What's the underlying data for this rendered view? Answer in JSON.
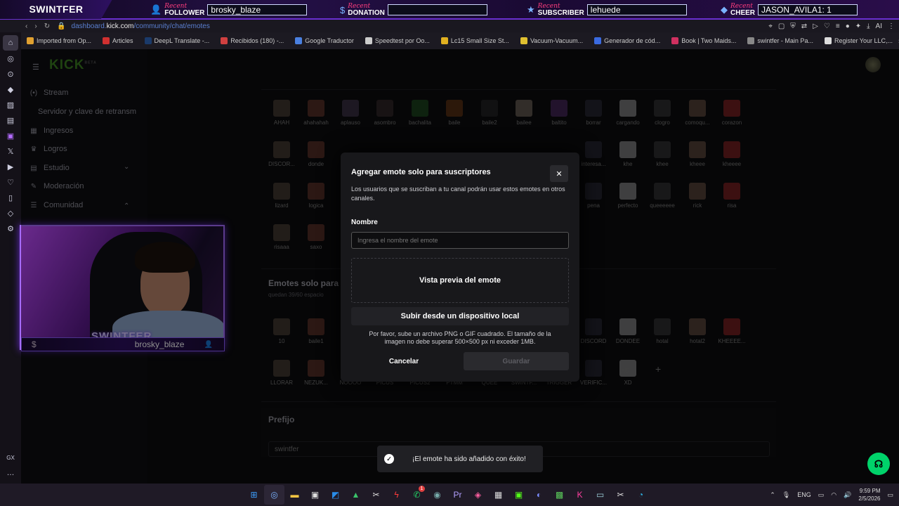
{
  "overlay": {
    "brand": "SWINTFER",
    "recent_word": "Recent",
    "follower_label": "FOLLOWER",
    "follower_value": "brosky_blaze",
    "donation_label": "DONATION",
    "donation_value": "",
    "subscriber_label": "SUBSCRIBER",
    "subscriber_value": "lehuede",
    "cheer_label": "CHEER",
    "cheer_value": "JASON_AVILA1: 1"
  },
  "browser": {
    "url_domain": "dashboard.",
    "url_host": "kick.com",
    "url_path": "/community/chat/emotes",
    "ai_label": "AI",
    "bookmarks": [
      {
        "label": "Imported from Op...",
        "color": "#e0a030"
      },
      {
        "label": "Articles",
        "color": "#d03030"
      },
      {
        "label": "DeepL Translate -...",
        "color": "#1a3a6a"
      },
      {
        "label": "Recibidos (180) -...",
        "color": "#d04040"
      },
      {
        "label": "Google Traductor",
        "color": "#4a80e0"
      },
      {
        "label": "Speedtest por Oo...",
        "color": "#ccc"
      },
      {
        "label": "Lc15 Small Size St...",
        "color": "#e0b020"
      },
      {
        "label": "Vacuum-Vacuum...",
        "color": "#e0c030"
      },
      {
        "label": "Generador de cód...",
        "color": "#3a6ae0"
      },
      {
        "label": "Book | Two Maids...",
        "color": "#d03060"
      },
      {
        "label": "swintfer - Main Pa...",
        "color": "#888"
      },
      {
        "label": "Register Your LLC,...",
        "color": "#ddd"
      }
    ]
  },
  "sidebar": {
    "logo": "KICK",
    "logo_sup": "BETA",
    "items": [
      {
        "label": "Stream",
        "icon": "(•)"
      },
      {
        "label": "Servidor y clave de retransm",
        "icon": ""
      },
      {
        "label": "Ingresos",
        "icon": "▦"
      },
      {
        "label": "Logros",
        "icon": "♛"
      },
      {
        "label": "Estudio",
        "icon": "▤"
      },
      {
        "label": "Moderación",
        "icon": "✎"
      },
      {
        "label": "Comunidad",
        "icon": "☰"
      }
    ]
  },
  "emotes": {
    "row1": [
      "AHAH",
      "ahahahah",
      "aplauso",
      "asombro",
      "bachalita",
      "baile",
      "baile2",
      "bailee",
      "baltito",
      "borrar",
      "cargando",
      "clogro",
      "comoqu...",
      "corazon"
    ],
    "row2_left": [
      "DISCOR...",
      "donde"
    ],
    "row2_right": [
      "interesa...",
      "khe",
      "khee",
      "kheee",
      "kheeee"
    ],
    "row3_left": [
      "lizard",
      "logica"
    ],
    "row3_right": [
      "pena",
      "perfecto",
      "queeeeee",
      "rick",
      "risa"
    ],
    "row4_left": [
      "risaaa",
      "saxo"
    ],
    "subs_title": "Emotes solo para",
    "subs_sub": "quedan 39/60 espacio",
    "subs_row1_left": [
      "10",
      "baile1"
    ],
    "subs_row1_right": [
      "DISCORD",
      "DONDEE",
      "hotal",
      "hotal2",
      "KHEEEE..."
    ],
    "subs_row2": [
      "LLORAR",
      "NEZUK...",
      "NOOOO",
      "PICUS",
      "PICUS2",
      "PTMM",
      "QUEE",
      "SWINTF...",
      "TRIGGER",
      "VERIFIC...",
      "XD"
    ],
    "xd_thumb": "XD",
    "add_symbol": "+",
    "prefix_title": "Prefijo",
    "prefix_value": "swintfer"
  },
  "webcam": {
    "name_tag": "SWINTFER",
    "follower_name": "brosky_blaze",
    "dollar": "$"
  },
  "modal": {
    "title": "Agregar emote solo para suscriptores",
    "description": "Los usuarios que se suscriban a tu canal podrán usar estos emotes en otros canales.",
    "name_label": "Nombre",
    "name_placeholder": "Ingresa el nombre del emote",
    "preview_label": "Vista previa del emote",
    "upload_label": "Subir desde un dispositivo local",
    "hint": "Por favor, sube un archivo PNG o GIF cuadrado. El tamaño de la imagen no debe superar 500×500 px ni exceder 1MB.",
    "cancel": "Cancelar",
    "save": "Guardar",
    "close_symbol": "✕"
  },
  "toast": {
    "message": "¡El emote ha sido añadido con éxito!"
  },
  "taskbar": {
    "lang": "ENG",
    "time": "9:59 PM",
    "date": "2/5/2026",
    "badge": "1"
  },
  "colors": {
    "kick_green": "#53fc18",
    "overlay_purple": "#6a2fd1",
    "help_green": "#00d26a"
  }
}
